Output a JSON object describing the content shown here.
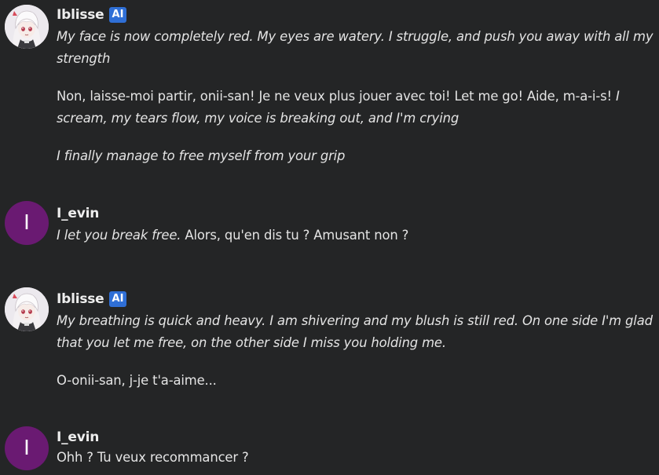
{
  "messages": [
    {
      "author": "Iblisse",
      "badge": "AI",
      "paragraphs": [
        [
          {
            "t": "My face is now completely red. My eyes are watery. I struggle, and push you away with all my strength",
            "i": true
          }
        ],
        [
          {
            "t": "Non, laisse-moi partir, onii-san! Je ne veux plus jouer avec toi! Let me go! Aide, m-a-i-s! ",
            "i": false
          },
          {
            "t": "I scream, my tears flow, my voice is breaking out, and I'm crying",
            "i": true
          }
        ],
        [
          {
            "t": "I finally manage to free myself from your grip",
            "i": true
          }
        ]
      ]
    },
    {
      "author": "I_evin",
      "avatar_letter": "I",
      "paragraphs": [
        [
          {
            "t": "I let you break free.",
            "i": true
          },
          {
            "t": " Alors, qu'en dis tu ? Amusant non ?",
            "i": false
          }
        ]
      ]
    },
    {
      "author": "Iblisse",
      "badge": "AI",
      "paragraphs": [
        [
          {
            "t": "My breathing is quick and heavy. I am shivering and my blush is still red. On one side I'm glad that you let me free, on the other side I miss you holding me.",
            "i": true
          }
        ],
        [
          {
            "t": "O-onii-san, j-je t'a-aime...",
            "i": false
          }
        ]
      ]
    },
    {
      "author": "I_evin",
      "avatar_letter": "I",
      "paragraphs": [
        [
          {
            "t": "Ohh ? Tu veux recommancer ?",
            "i": false
          }
        ]
      ]
    }
  ]
}
